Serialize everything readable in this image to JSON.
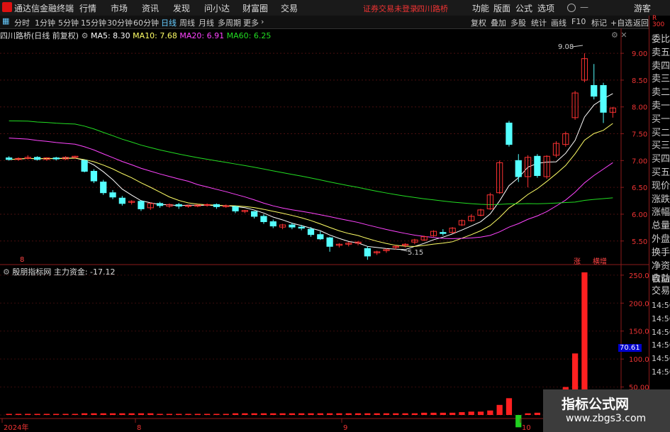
{
  "app": {
    "title": "通达信金融终端"
  },
  "menu": [
    "行情",
    "市场",
    "资讯",
    "发现",
    "问小达",
    "财富圈",
    "交易"
  ],
  "top_status": {
    "login": "证券交易未登录",
    "stock": "四川路桥"
  },
  "top_right": [
    "功能",
    "版面",
    "公式",
    "选项"
  ],
  "guest": "游客",
  "periods": [
    "分时",
    "1分钟",
    "5分钟",
    "15分钟",
    "30分钟",
    "60分钟",
    "日线",
    "周线",
    "月线",
    "多周期",
    "更多"
  ],
  "active_period": "日线",
  "toolbar_right": [
    "复权",
    "叠加",
    "多股",
    "统计",
    "画线",
    "F10",
    "标记",
    "+自选",
    "返回"
  ],
  "info": {
    "name": "四川路桥(日线 前复权)",
    "ma5": "MA5: 8.30",
    "ma10": "MA10: 7.68",
    "ma20": "MA20: 6.91",
    "ma60": "MA60: 6.25"
  },
  "indicator": {
    "name": "殷朋指标网",
    "label": "主力资金: -17.12",
    "current_value": "70.61"
  },
  "annotations": {
    "high": "9.08",
    "low": "5.15",
    "tag1": "涨",
    "tag2": "横增",
    "mark8": "8"
  },
  "right_panel": {
    "items": [
      "委比",
      "卖五",
      "卖四",
      "卖三",
      "卖二",
      "卖一",
      "买一",
      "买二",
      "买三",
      "买四",
      "买五",
      "现价",
      "涨跌",
      "涨幅",
      "总量",
      "外盘",
      "换手",
      "净资",
      "收益"
    ],
    "bottom": [
      "自动",
      "交易"
    ],
    "times": [
      "14:56",
      "14:56",
      "14:56",
      "14:56",
      "14:56",
      "14:56"
    ],
    "corner": [
      "R",
      "300"
    ]
  },
  "x_labels": [
    "2024年",
    "8",
    "9",
    "10"
  ],
  "watermark": {
    "line1": "指标公式网",
    "line2": "www.zbgs3.com"
  },
  "colors": {
    "up": "#ff3232",
    "down": "#54ffff",
    "ma5": "#ffffff",
    "ma10": "#ffff66",
    "ma20": "#ff44ff",
    "ma60": "#22dd22",
    "volume_up": "#ff2020",
    "volume_down": "#20d020"
  },
  "chart_data": {
    "type": "candlestick",
    "price_axis": [
      "9.00",
      "8.50",
      "8.00",
      "7.50",
      "7.00",
      "6.50",
      "6.00",
      "5.50"
    ],
    "price_range": [
      5.1,
      9.2
    ],
    "candles": [
      [
        7.05,
        7.08,
        7.02,
        7.0
      ],
      [
        7.02,
        7.06,
        7.04,
        7.0
      ],
      [
        7.04,
        7.1,
        7.06,
        7.02
      ],
      [
        7.06,
        7.08,
        7.02,
        7.0
      ],
      [
        7.02,
        7.06,
        7.05,
        7.0
      ],
      [
        7.05,
        7.07,
        7.03,
        7.0
      ],
      [
        7.03,
        7.08,
        7.06,
        7.01
      ],
      [
        7.06,
        7.09,
        7.08,
        7.03
      ],
      [
        7.0,
        7.02,
        6.8,
        6.78
      ],
      [
        6.8,
        6.84,
        6.62,
        6.58
      ],
      [
        6.6,
        6.64,
        6.4,
        6.36
      ],
      [
        6.4,
        6.45,
        6.32,
        6.28
      ],
      [
        6.3,
        6.34,
        6.2,
        6.16
      ],
      [
        6.22,
        6.26,
        6.24,
        6.18
      ],
      [
        6.24,
        6.26,
        6.1,
        6.06
      ],
      [
        6.12,
        6.22,
        6.2,
        6.08
      ],
      [
        6.2,
        6.23,
        6.16,
        6.12
      ],
      [
        6.15,
        6.2,
        6.18,
        6.12
      ],
      [
        6.18,
        6.21,
        6.15,
        6.1
      ],
      [
        6.15,
        6.18,
        6.16,
        6.12
      ],
      [
        6.15,
        6.18,
        6.17,
        6.13
      ],
      [
        6.17,
        6.2,
        6.18,
        6.14
      ],
      [
        6.18,
        6.2,
        6.14,
        6.1
      ],
      [
        6.14,
        6.18,
        6.16,
        6.12
      ],
      [
        6.14,
        6.16,
        6.06,
        6.02
      ],
      [
        6.05,
        6.08,
        6.07,
        6.02
      ],
      [
        6.05,
        6.06,
        5.96,
        5.92
      ],
      [
        5.96,
        6.0,
        5.86,
        5.82
      ],
      [
        5.86,
        5.9,
        5.78,
        5.74
      ],
      [
        5.76,
        5.82,
        5.8,
        5.72
      ],
      [
        5.8,
        5.84,
        5.76,
        5.72
      ],
      [
        5.76,
        5.8,
        5.74,
        5.7
      ],
      [
        5.72,
        5.76,
        5.62,
        5.58
      ],
      [
        5.62,
        5.68,
        5.54,
        5.52
      ],
      [
        5.56,
        5.58,
        5.4,
        5.3
      ],
      [
        5.42,
        5.46,
        5.44,
        5.38
      ],
      [
        5.44,
        5.48,
        5.46,
        5.4
      ],
      [
        5.46,
        5.5,
        5.48,
        5.42
      ],
      [
        5.36,
        5.4,
        5.22,
        5.15
      ],
      [
        5.28,
        5.32,
        5.3,
        5.24
      ],
      [
        5.32,
        5.36,
        5.34,
        5.28
      ],
      [
        5.38,
        5.42,
        5.4,
        5.34
      ],
      [
        5.42,
        5.46,
        5.44,
        5.38
      ],
      [
        5.48,
        5.54,
        5.52,
        5.44
      ],
      [
        5.52,
        5.6,
        5.58,
        5.5
      ],
      [
        5.6,
        5.7,
        5.68,
        5.58
      ],
      [
        5.66,
        5.72,
        5.64,
        5.6
      ],
      [
        5.66,
        5.76,
        5.74,
        5.64
      ],
      [
        5.8,
        5.9,
        5.88,
        5.78
      ],
      [
        5.88,
        6.0,
        5.96,
        5.86
      ],
      [
        5.98,
        6.1,
        6.08,
        5.96
      ],
      [
        6.1,
        6.4,
        6.36,
        6.08
      ],
      [
        6.4,
        7.0,
        6.96,
        6.38
      ],
      [
        7.7,
        7.74,
        7.3,
        7.26
      ],
      [
        7.0,
        7.12,
        6.7,
        6.6
      ],
      [
        6.7,
        7.1,
        7.06,
        6.5
      ],
      [
        7.08,
        7.12,
        6.72,
        6.68
      ],
      [
        6.7,
        7.1,
        7.08,
        6.66
      ],
      [
        7.1,
        7.36,
        7.32,
        7.06
      ],
      [
        7.3,
        7.54,
        7.5,
        7.26
      ],
      [
        7.8,
        8.3,
        8.26,
        7.76
      ],
      [
        8.5,
        9.0,
        8.9,
        8.46
      ],
      [
        8.4,
        8.8,
        8.2,
        8.14
      ],
      [
        8.4,
        8.45,
        7.9,
        7.7
      ],
      [
        7.9,
        8.0,
        7.98,
        7.8
      ]
    ],
    "volume": [
      2,
      2,
      2,
      2,
      2,
      2,
      2,
      2,
      3,
      3,
      3,
      3,
      3,
      3,
      3,
      3,
      2,
      2,
      2,
      2,
      2,
      2,
      2,
      2,
      3,
      3,
      3,
      3,
      3,
      3,
      3,
      3,
      3,
      3,
      3,
      3,
      3,
      3,
      3,
      3,
      3,
      3,
      3,
      3,
      4,
      4,
      4,
      4,
      5,
      6,
      6,
      8,
      18,
      30,
      -22,
      3,
      4,
      24,
      18,
      50,
      110,
      255,
      -6,
      -5,
      -4
    ],
    "volume_axis": [
      "250.0",
      "200.0",
      "150.0",
      "100.0",
      "50.00",
      "0.00"
    ],
    "x_labels": [
      "2024年",
      "8",
      "9",
      "10"
    ]
  }
}
